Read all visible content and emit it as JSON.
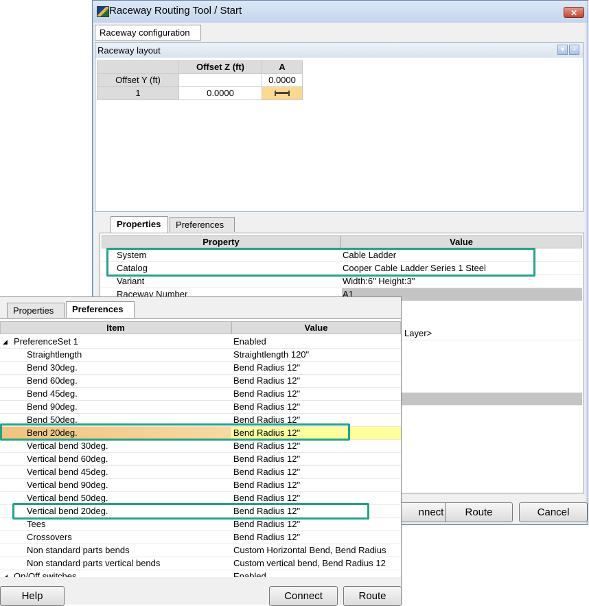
{
  "window": {
    "title": "Raceway Routing Tool / Start",
    "close_glyph": "✕"
  },
  "raceway_config_tab": "Raceway configuration",
  "layout": {
    "title": "Raceway layout",
    "grid": {
      "headers": [
        "",
        "Offset Z (ft)",
        "A"
      ],
      "offset_y_label": "Offset Y (ft)",
      "offset_y_value": "0.0000",
      "row_label": "1",
      "row_offset_z": "0.0000"
    }
  },
  "properties": {
    "tabs": [
      "Properties",
      "Preferences"
    ],
    "headers": [
      "Property",
      "Value"
    ],
    "rows": [
      {
        "property": "System",
        "value": "Cable Ladder"
      },
      {
        "property": "Catalog",
        "value": "Cooper Cable Ladder Series 1 Steel"
      },
      {
        "property": "Variant",
        "value": "Width:6\" Height:3\""
      },
      {
        "property": "Raceway Number",
        "value": "A1"
      }
    ],
    "partial_value": "Layer>"
  },
  "main_buttons": {
    "connect": "nnect",
    "route": "Route",
    "cancel": "Cancel"
  },
  "preferences": {
    "tabs": [
      "Properties",
      "Preferences"
    ],
    "headers": [
      "Item",
      "Value"
    ],
    "rows": [
      {
        "item": "PreferenceSet 1",
        "value": "Enabled",
        "group": true
      },
      {
        "item": "Straightlength",
        "value": "Straightlength 120\""
      },
      {
        "item": "Bend 30deg.",
        "value": "Bend Radius 12\""
      },
      {
        "item": "Bend 60deg.",
        "value": "Bend Radius 12\""
      },
      {
        "item": "Bend 45deg.",
        "value": "Bend Radius 12\""
      },
      {
        "item": "Bend 90deg.",
        "value": "Bend Radius 12\""
      },
      {
        "item": "Bend 50deg.",
        "value": "Bend Radius 12\""
      },
      {
        "item": "Bend 20deg.",
        "value": "Bend Radius 12\"",
        "selected": true
      },
      {
        "item": "Vertical bend 30deg.",
        "value": "Bend Radius 12\""
      },
      {
        "item": "Vertical bend 60deg.",
        "value": "Bend Radius 12\""
      },
      {
        "item": "Vertical bend 45deg.",
        "value": "Bend Radius 12\""
      },
      {
        "item": "Vertical bend 90deg.",
        "value": "Bend Radius 12\""
      },
      {
        "item": "Vertical bend 50deg.",
        "value": "Bend Radius 12\""
      },
      {
        "item": "Vertical bend 20deg.",
        "value": "Bend Radius 12\""
      },
      {
        "item": "Tees",
        "value": "Bend Radius 12\""
      },
      {
        "item": "Crossovers",
        "value": "Bend Radius 12\""
      },
      {
        "item": "Non standard parts bends",
        "value": "Custom Horizontal Bend, Bend Radius"
      },
      {
        "item": "Non standard parts vertical bends",
        "value": "Custom vertical bend, Bend Radius 12"
      },
      {
        "item": "On/Off switches",
        "value": "Enabled",
        "group": true
      }
    ]
  },
  "pref_buttons": {
    "help": "Help",
    "connect": "Connect",
    "route": "Route"
  },
  "colors": {
    "accent": "#1fa38a",
    "selected_row": "#f8cf8a",
    "selected_value": "#ffff99"
  }
}
